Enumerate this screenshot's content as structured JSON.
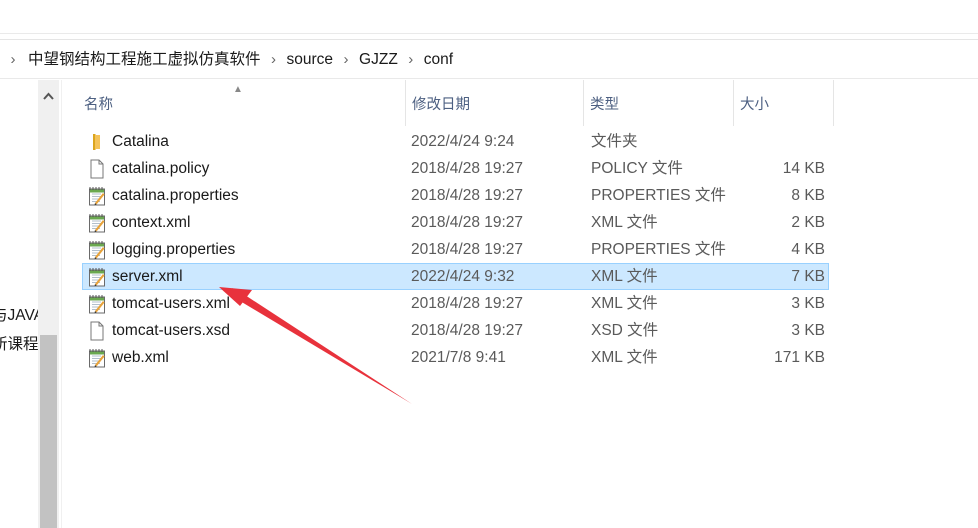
{
  "breadcrumb": [
    "中望钢结构工程施工虚拟仿真软件",
    "source",
    "GJZZ",
    "conf"
  ],
  "nav": {
    "partial_1": "与JAVA",
    "partial_2": "所课程"
  },
  "columns": {
    "name": "名称",
    "date": "修改日期",
    "type": "类型",
    "size": "大小"
  },
  "files": [
    {
      "name": "Catalina",
      "date": "2022/4/24 9:24",
      "type": "文件夹",
      "size": "",
      "icon": "folder-icon"
    },
    {
      "name": "catalina.policy",
      "date": "2018/4/28 19:27",
      "type": "POLICY 文件",
      "size": "14 KB",
      "icon": "blank-file-icon"
    },
    {
      "name": "catalina.properties",
      "date": "2018/4/28 19:27",
      "type": "PROPERTIES 文件",
      "size": "8 KB",
      "icon": "notepad-file-icon"
    },
    {
      "name": "context.xml",
      "date": "2018/4/28 19:27",
      "type": "XML 文件",
      "size": "2 KB",
      "icon": "notepad-file-icon"
    },
    {
      "name": "logging.properties",
      "date": "2018/4/28 19:27",
      "type": "PROPERTIES 文件",
      "size": "4 KB",
      "icon": "notepad-file-icon"
    },
    {
      "name": "server.xml",
      "date": "2022/4/24 9:32",
      "type": "XML 文件",
      "size": "7 KB",
      "icon": "notepad-file-icon",
      "selected": true
    },
    {
      "name": "tomcat-users.xml",
      "date": "2018/4/28 19:27",
      "type": "XML 文件",
      "size": "3 KB",
      "icon": "notepad-file-icon"
    },
    {
      "name": "tomcat-users.xsd",
      "date": "2018/4/28 19:27",
      "type": "XSD 文件",
      "size": "3 KB",
      "icon": "blank-file-icon"
    },
    {
      "name": "web.xml",
      "date": "2021/7/8 9:41",
      "type": "XML 文件",
      "size": "171 KB",
      "icon": "notepad-file-icon"
    }
  ],
  "colors": {
    "selection_bg": "#cce8ff",
    "selection_border": "#99d1ff",
    "annotation_arrow": "#e8323c"
  }
}
